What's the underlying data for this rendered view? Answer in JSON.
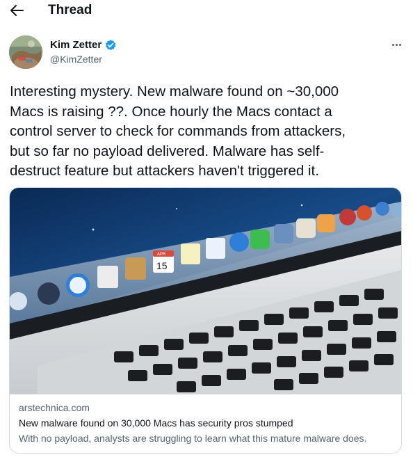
{
  "header": {
    "title": "Thread",
    "back_icon": "arrow-left-icon"
  },
  "tweet": {
    "author": {
      "name": "Kim Zetter",
      "handle": "@KimZetter",
      "verified": true,
      "verified_color": "#1d9bf0"
    },
    "text": "Interesting mystery. New malware found on ~30,000\nMacs is raising ??. Once hourly the Macs contact a\ncontrol server to check for commands from attackers,\nbut so far no payload delivered. Malware has self-\ndestruct feature but attackers haven't triggered it.",
    "more_icon": "more-horizontal-icon"
  },
  "card": {
    "domain": "arstechnica.com",
    "title": "New malware found on 30,000 Macs has security pros stumped",
    "description": "With no payload, analysts are struggling to learn what this mature malware does.",
    "calendar_month": "APR",
    "calendar_day": "15"
  },
  "colors": {
    "text": "#0f1419",
    "secondary": "#536471",
    "border": "#cfd9de",
    "accent": "#1d9bf0"
  }
}
